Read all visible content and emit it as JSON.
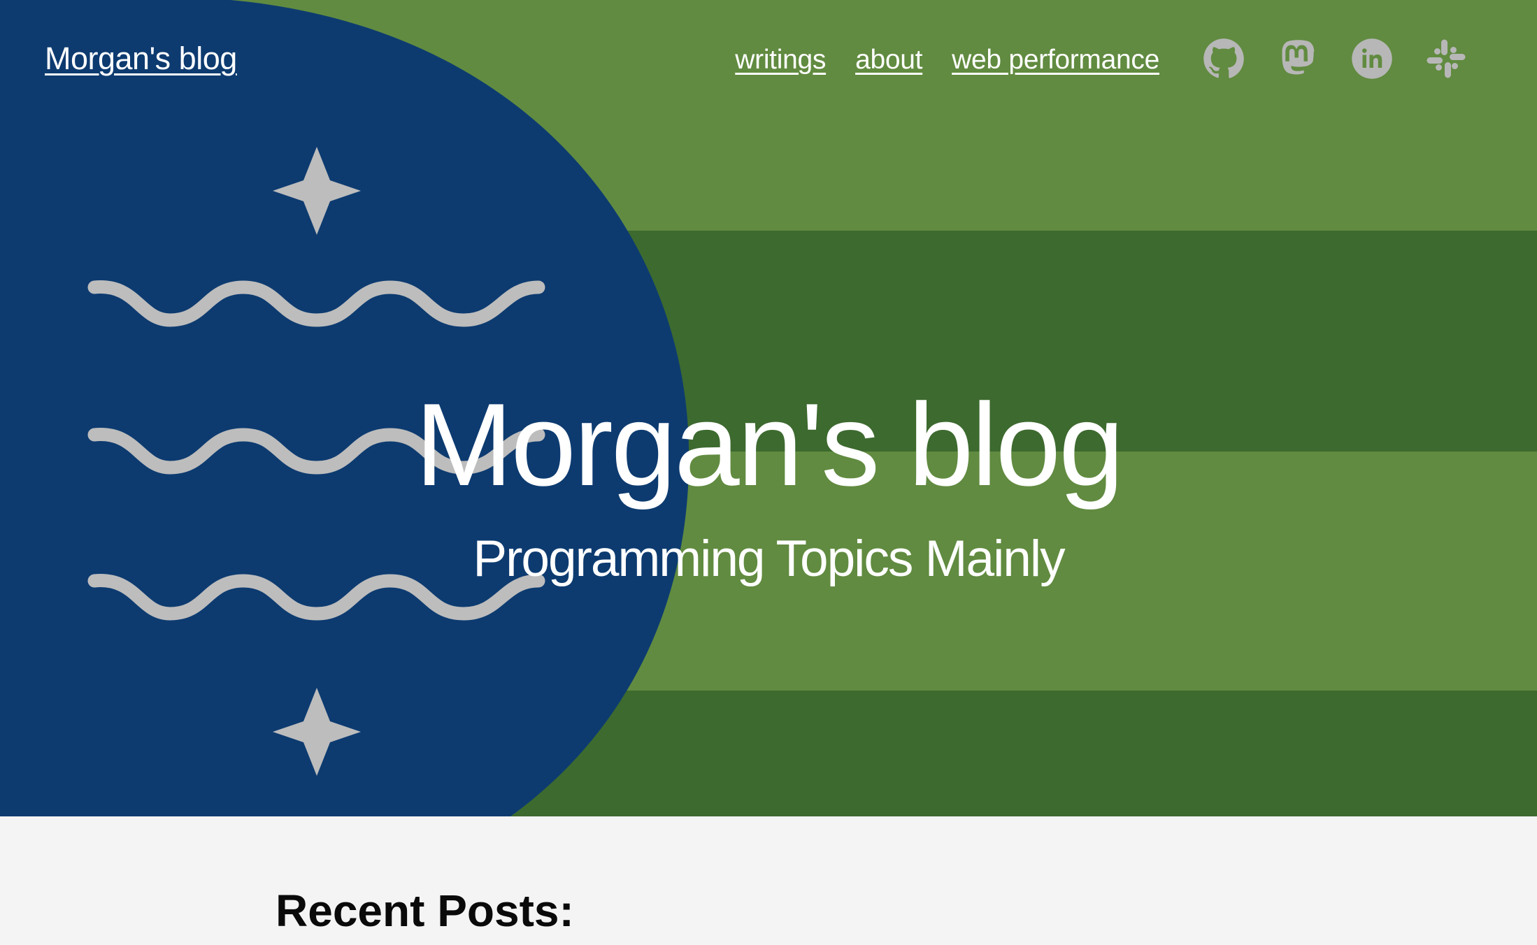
{
  "site": {
    "name": "Morgan's blog"
  },
  "nav": {
    "links": [
      {
        "label": "writings"
      },
      {
        "label": "about"
      },
      {
        "label": "web performance"
      }
    ],
    "social_icons": [
      "github-icon",
      "mastodon-icon",
      "linkedin-icon",
      "slack-icon"
    ]
  },
  "hero": {
    "title": "Morgan's blog",
    "subtitle": "Programming Topics Mainly"
  },
  "main": {
    "recent_heading": "Recent Posts:"
  },
  "colors": {
    "hero_green_light": "#618b40",
    "hero_green_dark": "#3d6a2f",
    "circle_blue": "#0d3b70",
    "decoration_gray": "#bdbdbd",
    "icon_gray": "#b7b7b7",
    "page_background": "#f4f4f4"
  }
}
